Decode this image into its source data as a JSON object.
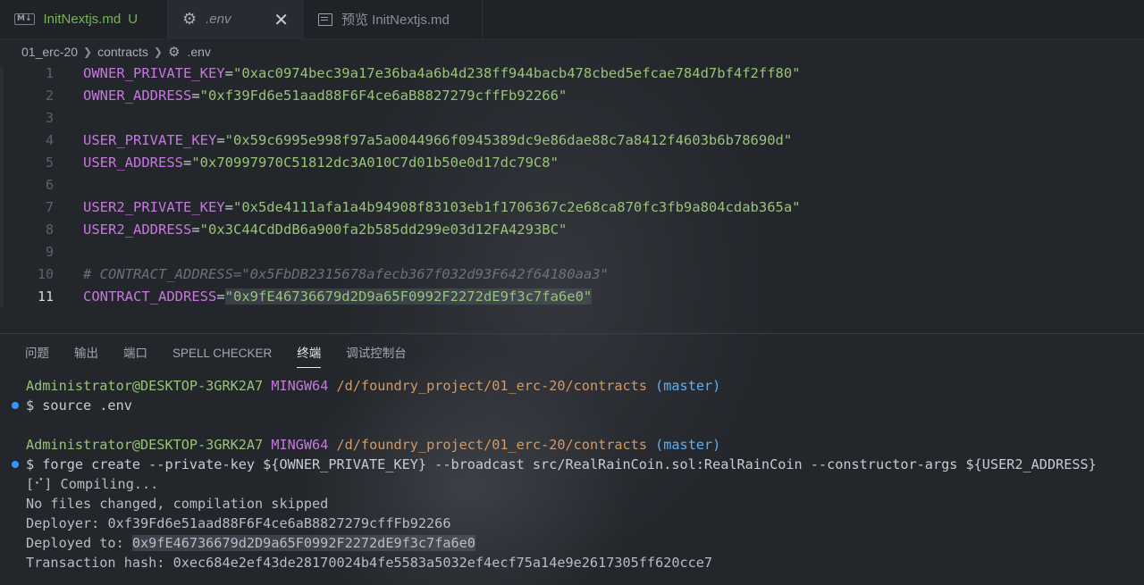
{
  "tabs": [
    {
      "icon": "M↓",
      "label": "InitNextjs.md",
      "status": "U"
    },
    {
      "label": ".env",
      "close": "✕"
    },
    {
      "label": "预览 InitNextjs.md"
    }
  ],
  "breadcrumb": [
    "01_erc-20",
    "contracts",
    ".env"
  ],
  "editor": {
    "lines": [
      {
        "n": "1",
        "key": "OWNER_PRIVATE_KEY",
        "value": "\"0xac0974bec39a17e36ba4a6b4d238ff944bacb478cbed5efcae784d7bf4f2ff80\""
      },
      {
        "n": "2",
        "key": "OWNER_ADDRESS",
        "value": "\"0xf39Fd6e51aad88F6F4ce6aB8827279cffFb92266\""
      },
      {
        "n": "3"
      },
      {
        "n": "4",
        "key": "USER_PRIVATE_KEY",
        "value": "\"0x59c6995e998f97a5a0044966f0945389dc9e86dae88c7a8412f4603b6b78690d\""
      },
      {
        "n": "5",
        "key": "USER_ADDRESS",
        "value": "\"0x70997970C51812dc3A010C7d01b50e0d17dc79C8\""
      },
      {
        "n": "6"
      },
      {
        "n": "7",
        "key": "USER2_PRIVATE_KEY",
        "value": "\"0x5de4111afa1a4b94908f83103eb1f1706367c2e68ca870fc3fb9a804cdab365a\""
      },
      {
        "n": "8",
        "key": "USER2_ADDRESS",
        "value": "\"0x3C44CdDdB6a900fa2b585dd299e03d12FA4293BC\""
      },
      {
        "n": "9"
      },
      {
        "n": "10",
        "comment": "# CONTRACT_ADDRESS=\"0x5FbDB2315678afecb367f032d93F642f64180aa3\""
      },
      {
        "n": "11",
        "key": "CONTRACT_ADDRESS",
        "value": "\"0x9fE46736679d2D9a65F0992F2272dE9f3c7fa6e0\""
      }
    ]
  },
  "panel": {
    "tabs": [
      "问题",
      "输出",
      "端口",
      "SPELL CHECKER",
      "终端",
      "调试控制台"
    ],
    "active_tab": "终端"
  },
  "terminal": {
    "prompt1": {
      "user": "Administrator@DESKTOP-3GRK2A7",
      "host": "MINGW64",
      "path": "/d/foundry_project/01_erc-20/contracts",
      "branch": "(master)"
    },
    "cmd1": "$ source .env",
    "prompt2": {
      "user": "Administrator@DESKTOP-3GRK2A7",
      "host": "MINGW64",
      "path": "/d/foundry_project/01_erc-20/contracts",
      "branch": "(master)"
    },
    "cmd2": "$ forge create --private-key ${OWNER_PRIVATE_KEY} --broadcast src/RealRainCoin.sol:RealRainCoin --constructor-args ${USER2_ADDRESS}",
    "out1": "[⠊] Compiling...",
    "out2": "No files changed, compilation skipped",
    "deployer_label": "Deployer: ",
    "deployer": "0xf39Fd6e51aad88F6F4ce6aB8827279cffFb92266",
    "deployed_label": "Deployed to: ",
    "deployed": "0x9fE46736679d2D9a65F0992F2272dE9f3c7fa6e0",
    "tx_label": "Transaction hash: ",
    "tx": "0xec684e2ef43de28170024b4fe5583a5032ef4ecf75a14e9e2617305ff620cce7"
  },
  "colors": {
    "key": "#c678dd",
    "string": "#98c379",
    "comment": "#6b707a",
    "path": "#d19a66",
    "branch": "#61afef",
    "accent_dot": "#3794ff"
  }
}
